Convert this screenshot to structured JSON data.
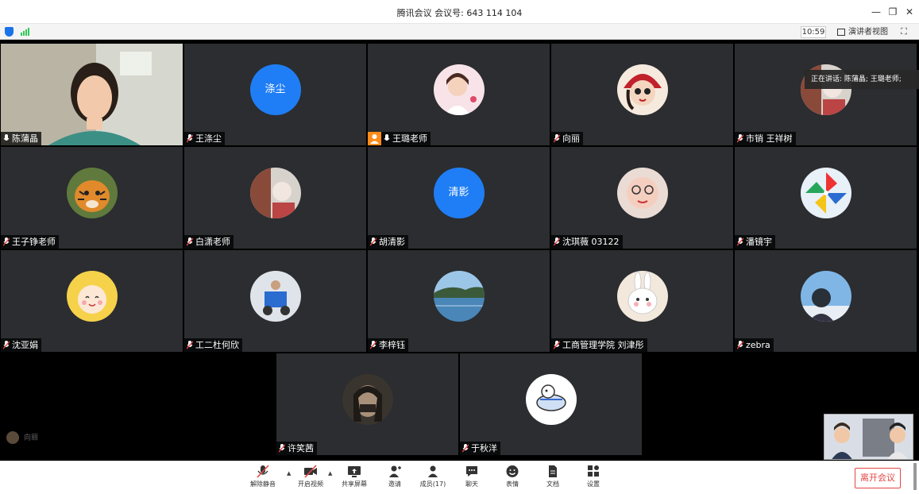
{
  "window": {
    "title": "腾讯会议 会议号: 643 114 104",
    "minimize_icon": "minimize-icon",
    "restore_icon": "restore-icon",
    "close_icon": "close-icon"
  },
  "status_bar": {
    "time": "10:59",
    "speaker_view_label": "演讲者视图",
    "security_icon": "shield-icon",
    "signal_icon": "signal-icon",
    "fullscreen_icon": "fullscreen-icon"
  },
  "speaking_indicator": "正在讲话: 陈蒲晶; 王璐老师;",
  "participants": [
    {
      "name": "陈蒲晶",
      "avatar": "camera-video",
      "mic": "on"
    },
    {
      "name": "王涤尘",
      "avatar_text": "涤尘",
      "mic": "muted"
    },
    {
      "name": "王璐老师",
      "avatar": "photo-girl",
      "mic": "on",
      "host": true
    },
    {
      "name": "向丽",
      "avatar": "cartoon-girl",
      "mic": "muted"
    },
    {
      "name": "市销 王祥树",
      "avatar": "photo",
      "mic": "muted"
    },
    {
      "name": "王子铮老师",
      "avatar": "tiger",
      "mic": "muted"
    },
    {
      "name": "白潇老师",
      "avatar": "photo",
      "mic": "muted"
    },
    {
      "name": "胡清影",
      "avatar_text": "清影",
      "mic": "muted"
    },
    {
      "name": "沈琪薇 03122",
      "avatar": "photo-face",
      "mic": "muted"
    },
    {
      "name": "潘镜宇",
      "avatar": "pinwheel",
      "mic": "muted"
    },
    {
      "name": "沈亚娟",
      "avatar": "anime",
      "mic": "muted"
    },
    {
      "name": "工二杜何欣",
      "avatar": "tricycle",
      "mic": "muted"
    },
    {
      "name": "李梓钰",
      "avatar": "lake",
      "mic": "muted"
    },
    {
      "name": "工商管理学院 刘津彤",
      "avatar": "rabbit",
      "mic": "muted"
    },
    {
      "name": "zebra",
      "avatar": "person-sky",
      "mic": "muted"
    },
    {
      "name": "许笑茜",
      "avatar": "dark-face",
      "mic": "muted"
    },
    {
      "name": "于秋洋",
      "avatar": "cartoon-dog",
      "mic": "muted"
    }
  ],
  "away_user": "向丽",
  "toolbar": {
    "unmute": "解除静音",
    "start_video": "开启视频",
    "share_screen": "共享屏幕",
    "invite": "邀请",
    "members": "成员(17)",
    "chat": "聊天",
    "reactions": "表情",
    "documents": "文档",
    "settings": "设置",
    "leave": "离开会议"
  },
  "colors": {
    "accent_blue": "#1f7ef5",
    "leave_red": "#e54545",
    "tile_bg": "#2b2d30",
    "host_orange": "#ff8c1a"
  }
}
